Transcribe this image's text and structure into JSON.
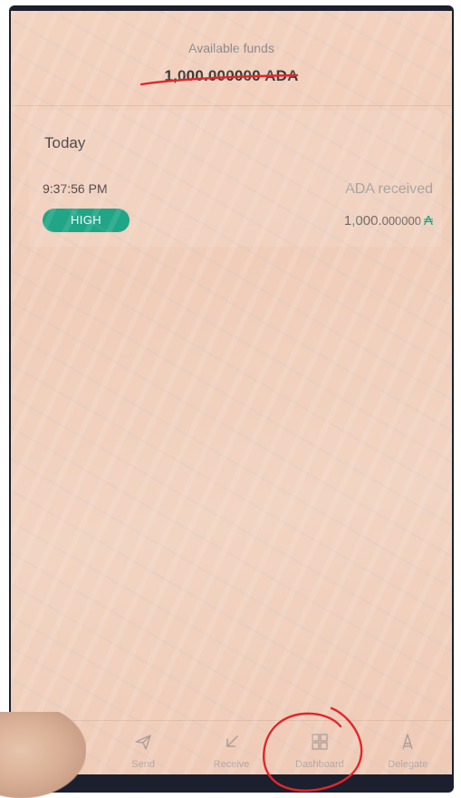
{
  "header": {
    "available_funds_label": "Available funds",
    "available_funds_amount": "1,000.000000 ADA"
  },
  "transactions": {
    "date_heading": "Today",
    "items": [
      {
        "time": "9:37:56 PM",
        "type": "ADA received",
        "assurance_badge": "HIGH",
        "amount_integer": "1,000.",
        "amount_decimals": "000000",
        "currency_symbol": "₳"
      }
    ]
  },
  "bottom_nav": {
    "items": [
      {
        "label": "",
        "icon": "transactions-icon"
      },
      {
        "label": "Send",
        "icon": "send-icon"
      },
      {
        "label": "Receive",
        "icon": "receive-icon"
      },
      {
        "label": "Dashboard",
        "icon": "dashboard-icon"
      },
      {
        "label": "Delegate",
        "icon": "delegate-icon"
      }
    ]
  },
  "colors": {
    "accent_green": "#20a586",
    "annotation_red": "#e3262b",
    "background": "#f2d2bf"
  }
}
